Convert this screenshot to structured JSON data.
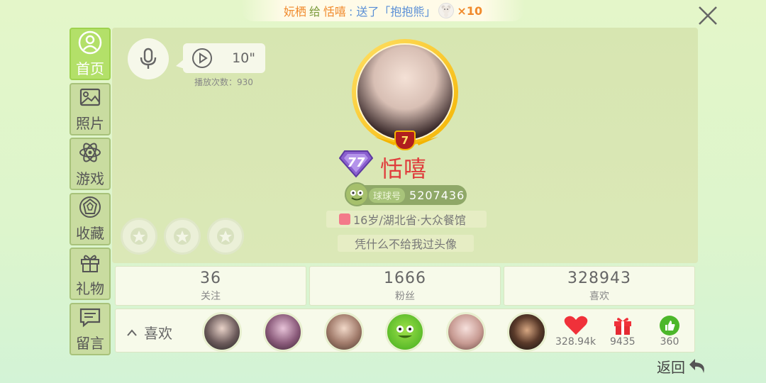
{
  "notification": {
    "sender": "妧栖",
    "verb": "给",
    "receiver": "恬嘻",
    "message": ": 送了「抱抱熊」",
    "gift_icon": "teddy-bear-icon",
    "count": "×10"
  },
  "sidebar": {
    "items": [
      {
        "label": "首页",
        "icon": "user-icon",
        "active": true
      },
      {
        "label": "照片",
        "icon": "photo-icon",
        "active": false
      },
      {
        "label": "游戏",
        "icon": "atom-icon",
        "active": false
      },
      {
        "label": "收藏",
        "icon": "gem-icon",
        "active": false
      },
      {
        "label": "礼物",
        "icon": "gift-icon",
        "active": false
      },
      {
        "label": "留言",
        "icon": "message-icon",
        "active": false
      }
    ]
  },
  "profile": {
    "voice_duration": "10\"",
    "play_count": "播放次数：930",
    "level": "7",
    "vip_level": "77",
    "username": "恬嘻",
    "qiuqiu_label": "球球号",
    "qiuqiu_id": "5207436",
    "info": "16岁/湖北省·大众餐馆",
    "signature": "凭什么不给我过头像"
  },
  "stats": [
    {
      "value": "36",
      "label": "关注"
    },
    {
      "value": "1666",
      "label": "粉丝"
    },
    {
      "value": "328943",
      "label": "喜欢"
    }
  ],
  "likes_row": {
    "title": "喜欢",
    "heart_count": "328.94k",
    "gift_count": "9435",
    "thumb_count": "360"
  },
  "back_label": "返回",
  "colors": {
    "accent_green": "#b3e069",
    "username_red": "#e03c3c",
    "notice_orange": "#f08a2c",
    "notice_blue": "#5a8fd6"
  }
}
